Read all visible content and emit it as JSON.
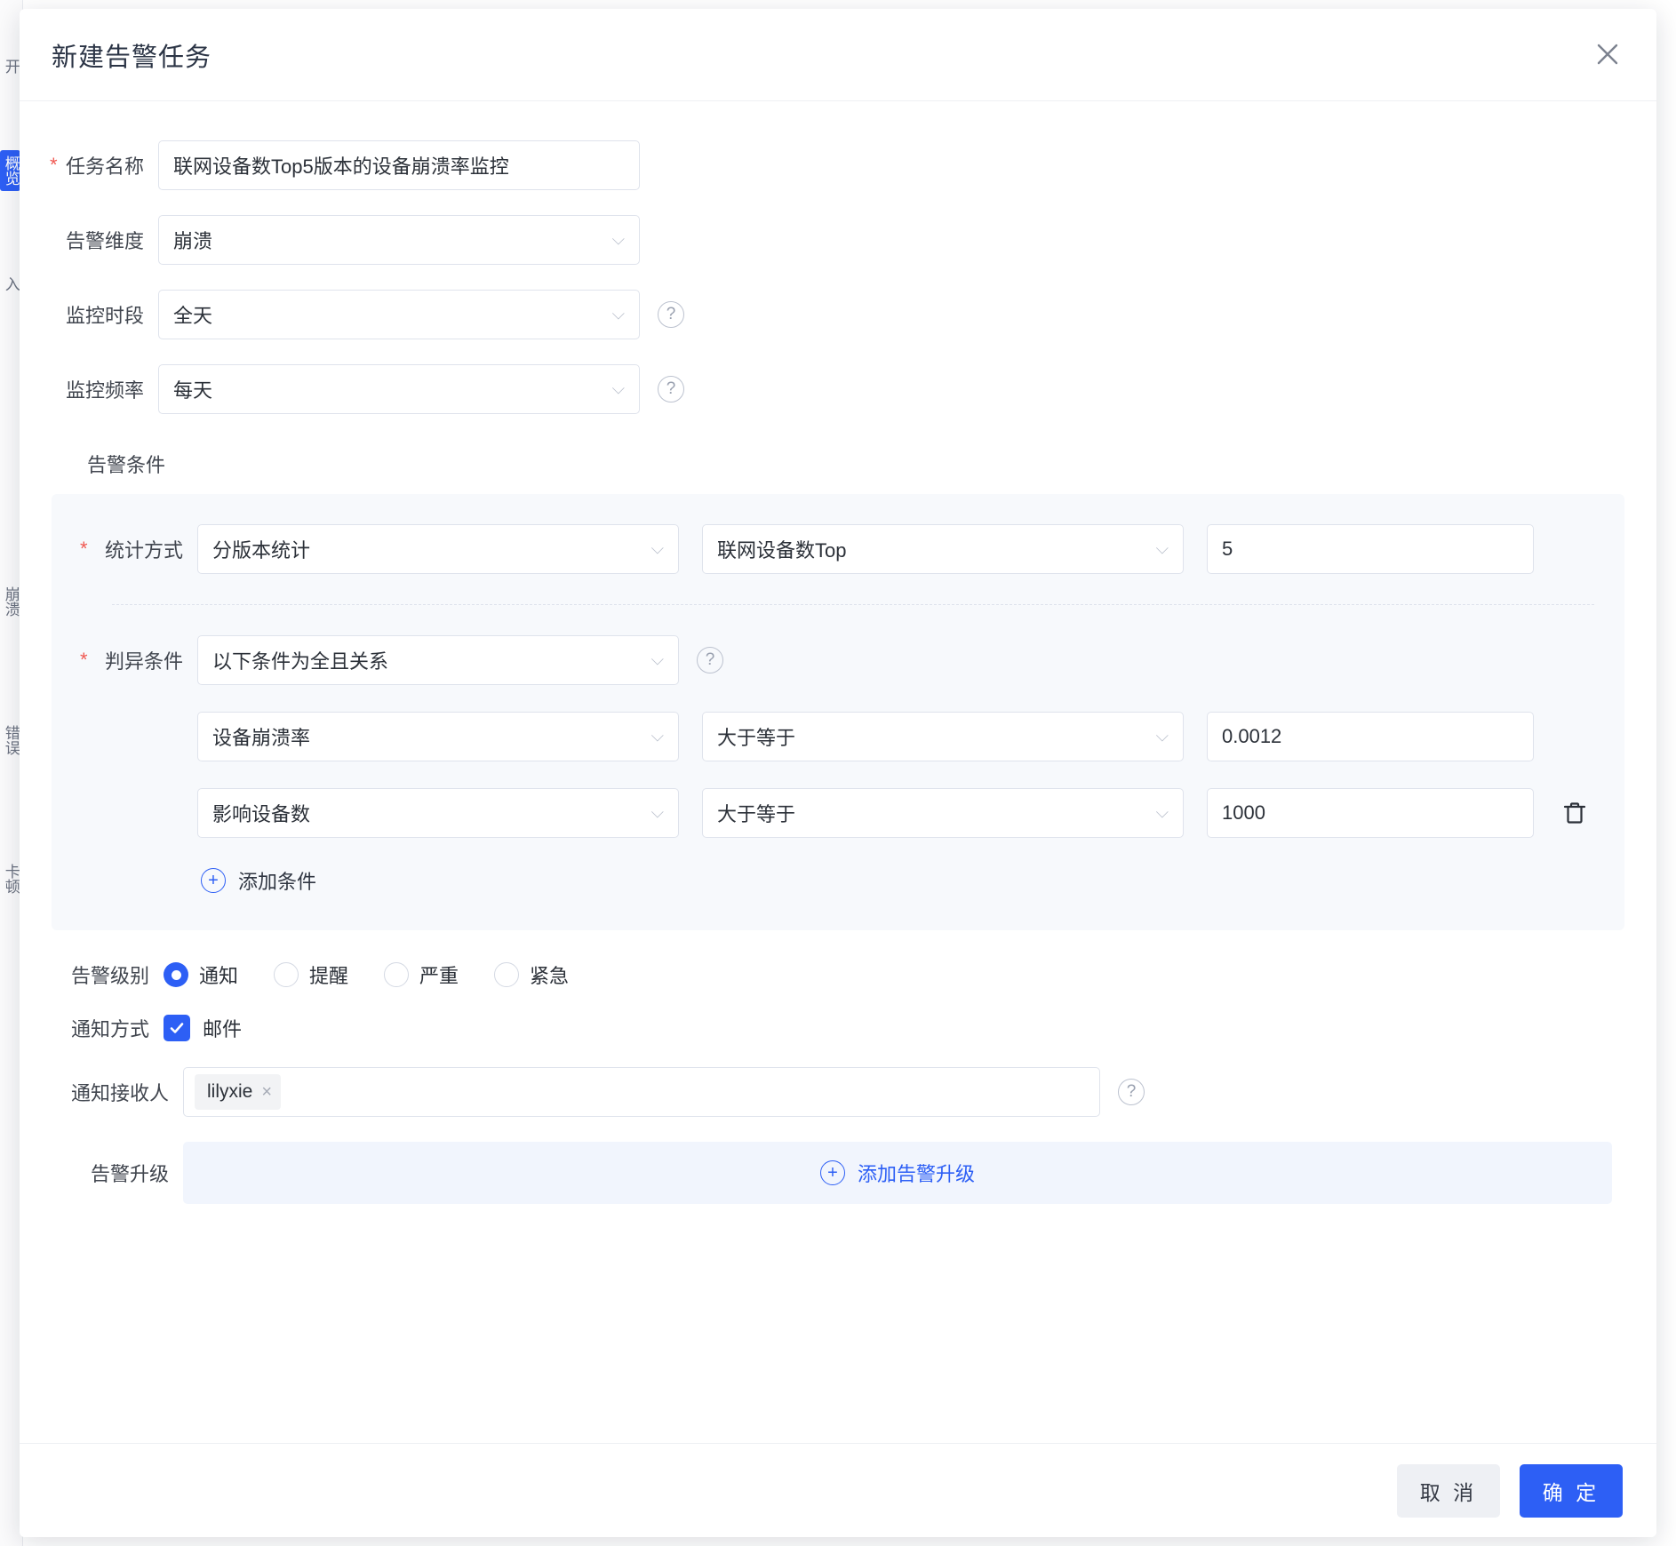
{
  "background": {
    "sidebar_items": [
      {
        "label": "开",
        "selected": false
      },
      {
        "label": "概览",
        "selected": true
      },
      {
        "label": "入",
        "selected": false
      },
      {
        "label": "崩溃",
        "selected": false
      },
      {
        "label": "错误",
        "selected": false
      },
      {
        "label": "卡顿",
        "selected": false
      }
    ]
  },
  "modal": {
    "title": "新建告警任务",
    "close_icon": "close-icon",
    "fields": {
      "task_name": {
        "label": "任务名称",
        "required": true,
        "value": "联网设备数Top5版本的设备崩溃率监控",
        "placeholder": "请输入任务名称"
      },
      "alert_dimension": {
        "label": "告警维度",
        "required": false,
        "value": "崩溃",
        "caret_icon": "chevron-down-icon"
      },
      "monitor_period": {
        "label": "监控时段",
        "required": false,
        "value": "全天",
        "caret_icon": "chevron-down-icon",
        "help_icon": "question-circle-icon"
      },
      "monitor_frequency": {
        "label": "监控频率",
        "required": false,
        "value": "每天",
        "caret_icon": "chevron-down-icon",
        "help_icon": "question-circle-icon"
      }
    },
    "alert_condition": {
      "section_label": "告警条件",
      "statistic": {
        "label": "统计方式",
        "required": true,
        "method": "分版本统计",
        "metric": "联网设备数Top",
        "top_n": "5"
      },
      "anomaly": {
        "label": "判异条件",
        "required": true,
        "relation": "以下条件为全且关系",
        "help_icon": "question-circle-icon",
        "rows": [
          {
            "metric": "设备崩溃率",
            "operator": "大于等于",
            "value": "0.0012",
            "has_delete": false
          },
          {
            "metric": "影响设备数",
            "operator": "大于等于",
            "value": "1000",
            "has_delete": true,
            "delete_icon": "trash-icon"
          }
        ],
        "add_label": "添加条件",
        "add_icon": "plus-circle-icon"
      }
    },
    "alert_level": {
      "label": "告警级别",
      "options": [
        {
          "label": "通知",
          "selected": true
        },
        {
          "label": "提醒",
          "selected": false
        },
        {
          "label": "严重",
          "selected": false
        },
        {
          "label": "紧急",
          "selected": false
        }
      ]
    },
    "notify_method": {
      "label": "通知方式",
      "options": [
        {
          "label": "邮件",
          "checked": true,
          "icon": "checkbox-checked-icon"
        }
      ]
    },
    "notify_receiver": {
      "label": "通知接收人",
      "tags": [
        {
          "label": "lilyxie",
          "remove_icon": "close-small-icon"
        }
      ],
      "placeholder": "请选择通知接收人",
      "help_icon": "question-circle-icon"
    },
    "alert_escalation": {
      "label": "告警升级",
      "add_label": "添加告警升级",
      "add_icon": "plus-circle-icon"
    },
    "footer": {
      "cancel_label": "取 消",
      "confirm_label": "确 定"
    }
  },
  "colors": {
    "primary": "#2d5ff5",
    "required_star": "#f05a53",
    "panel_bg": "#f7f9fc",
    "escalation_bg": "#f1f5fd"
  }
}
